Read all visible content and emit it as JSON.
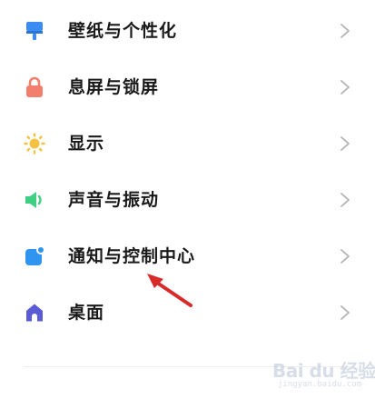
{
  "settings": {
    "items": [
      {
        "label": "壁纸与个性化",
        "icon": "paint-brush-icon",
        "icon_color": "#3a8cf2"
      },
      {
        "label": "息屏与锁屏",
        "icon": "lock-icon",
        "icon_color": "#f27f6d"
      },
      {
        "label": "显示",
        "icon": "sun-icon",
        "icon_color": "#f5c242"
      },
      {
        "label": "声音与振动",
        "icon": "speaker-icon",
        "icon_color": "#3ecf82"
      },
      {
        "label": "通知与控制中心",
        "icon": "notification-icon",
        "icon_color": "#2f95f0"
      },
      {
        "label": "桌面",
        "icon": "home-icon",
        "icon_color": "#5b5bd6"
      }
    ]
  },
  "annotation": {
    "arrow_color": "#d92a2a"
  },
  "watermark": {
    "brand": "Bai du 经验",
    "sub": "jingyan.baidu.com"
  }
}
